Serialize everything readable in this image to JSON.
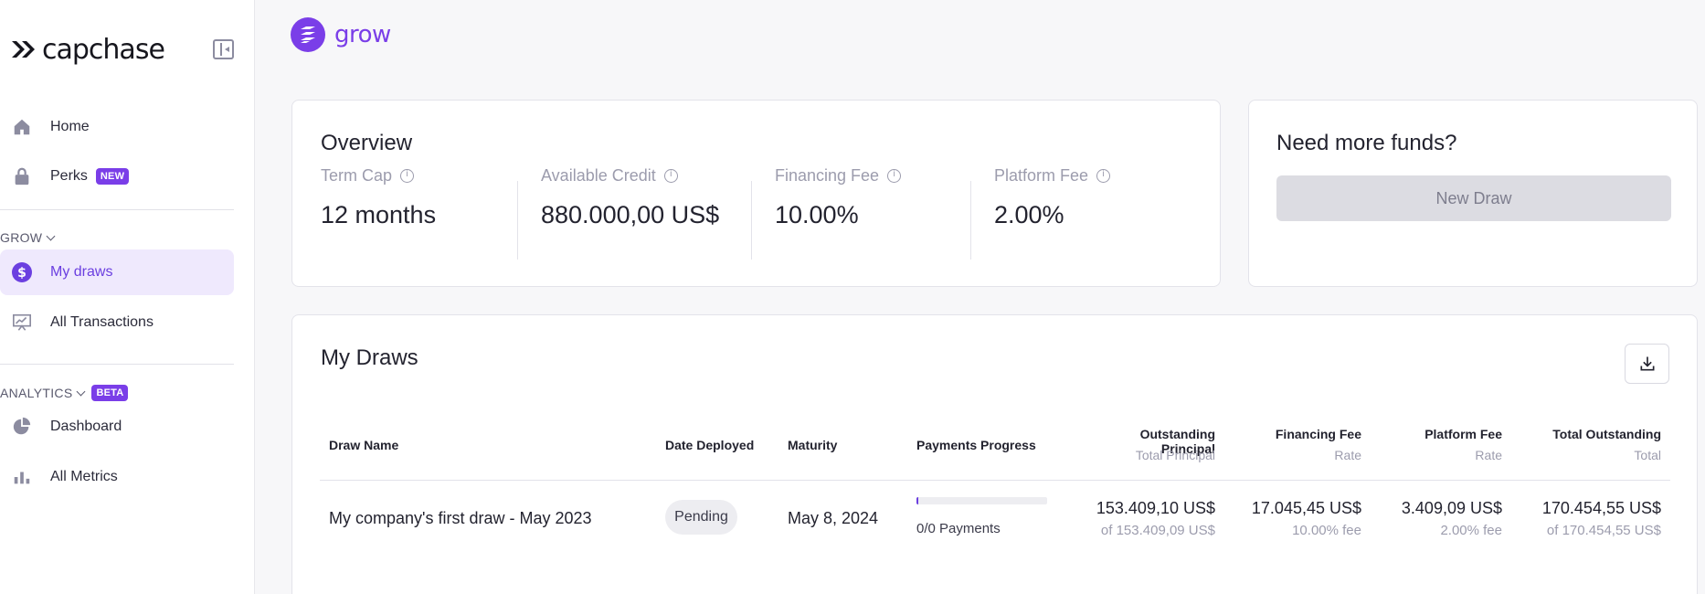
{
  "brand": {
    "name": "capchase"
  },
  "sidebar": {
    "home": "Home",
    "perks": "Perks",
    "perks_badge": "NEW",
    "grow_section": "GROW",
    "my_draws": "My draws",
    "all_transactions": "All Transactions",
    "analytics_section": "ANALYTICS",
    "analytics_badge": "BETA",
    "dashboard": "Dashboard",
    "all_metrics": "All Metrics"
  },
  "product": {
    "name": "grow"
  },
  "overview": {
    "title": "Overview",
    "stats": [
      {
        "label": "Term Cap",
        "value": "12 months"
      },
      {
        "label": "Available Credit",
        "value": "880.000,00 US$"
      },
      {
        "label": "Financing Fee",
        "value": "10.00%"
      },
      {
        "label": "Platform Fee",
        "value": "2.00%"
      }
    ]
  },
  "funds": {
    "title": "Need more funds?",
    "button": "New Draw"
  },
  "draws": {
    "title": "My Draws",
    "columns": {
      "draw_name": "Draw Name",
      "date_deployed": "Date Deployed",
      "maturity": "Maturity",
      "payments_progress": "Payments Progress",
      "outstanding_principal": "Outstanding Principal",
      "outstanding_principal_sub": "Total Principal",
      "financing_fee": "Financing Fee",
      "financing_fee_sub": "Rate",
      "platform_fee": "Platform Fee",
      "platform_fee_sub": "Rate",
      "total_outstanding": "Total Outstanding",
      "total_outstanding_sub": "Total"
    },
    "rows": [
      {
        "name": "My company's first draw - May 2023",
        "date_deployed": "Pending",
        "maturity": "May 8, 2024",
        "payments_progress": 0,
        "payments_text": "0/0 Payments",
        "outstanding_principal": "153.409,10 US$",
        "total_principal": "of 153.409,09 US$",
        "financing_fee": "17.045,45 US$",
        "financing_rate": "10.00% fee",
        "platform_fee": "3.409,09 US$",
        "platform_rate": "2.00% fee",
        "total_outstanding": "170.454,55 US$",
        "total": "of 170.454,55 US$"
      }
    ]
  },
  "colors": {
    "accent": "#7a3ee8",
    "active_bg": "#efe9fd",
    "muted": "#9c9cad"
  }
}
